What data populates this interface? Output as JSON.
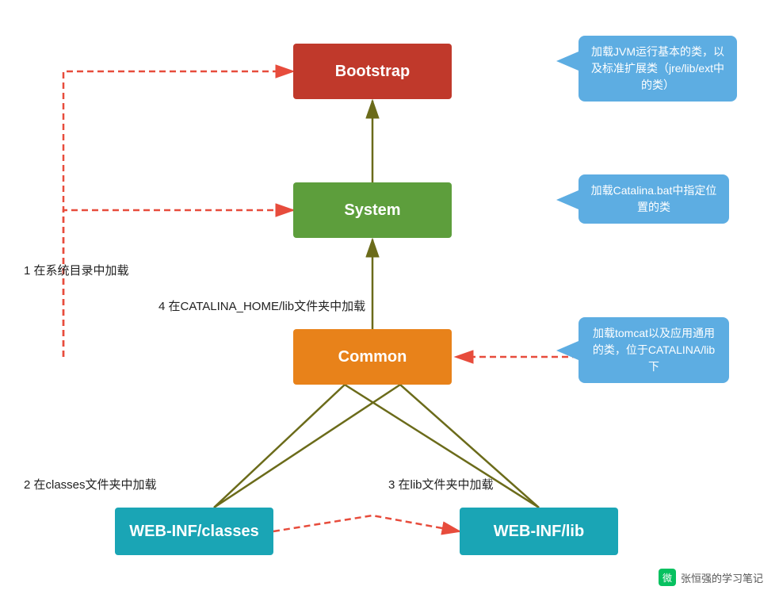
{
  "boxes": {
    "bootstrap": {
      "label": "Bootstrap"
    },
    "system": {
      "label": "System"
    },
    "common": {
      "label": "Common"
    },
    "webinf_classes": {
      "label": "WEB-INF/classes"
    },
    "webinf_lib": {
      "label": "WEB-INF/lib"
    }
  },
  "callouts": {
    "bootstrap": {
      "text": "加载JVM运行基本的类，以及标准扩展类（jre/lib/ext中的类）"
    },
    "system": {
      "text": "加载Catalina.bat中指定位置的类"
    },
    "common": {
      "text": "加载tomcat以及应用通用的类，位于CATALINA/lib下"
    }
  },
  "labels": {
    "label1": "1 在系统目录中加载",
    "label2": "2 在classes文件夹中加载",
    "label3": "3 在lib文件夹中加载",
    "label4": "4 在CATALINA_HOME/lib文件夹中加载"
  },
  "watermark": "张恒强的学习笔记"
}
